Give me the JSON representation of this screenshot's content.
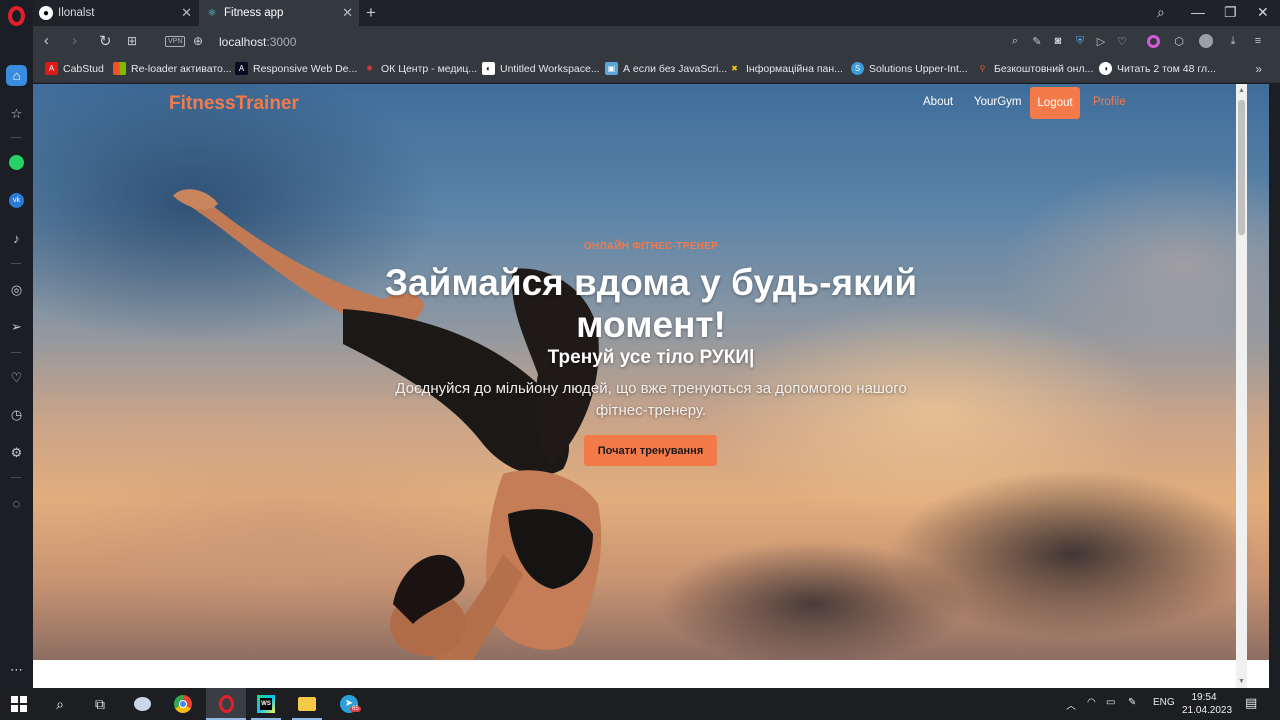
{
  "browser": {
    "tabs": [
      {
        "title": "Ilonalst",
        "icon": "github-icon"
      },
      {
        "title": "Fitness app",
        "icon": "react-icon"
      }
    ],
    "url_host": "localhost",
    "url_port": ":3000",
    "vpn_label": "VPN",
    "bookmarks": [
      "CabStud",
      "Re-loader активато...",
      "Responsive Web De...",
      "ОК Центр - медиц...",
      "Untitled Workspace...",
      "А если без JavaScri...",
      "Інформаційна пан...",
      "Solutions Upper-Int...",
      "Безкоштовний онл...",
      "Читать 2 том 48 гл..."
    ]
  },
  "site": {
    "brand": "FitnessTrainer",
    "nav": {
      "about": "About",
      "yourgym": "YourGym",
      "logout": "Logout",
      "profile": "Profile"
    },
    "hero": {
      "kicker": "ОНЛАЙН ФІТНЕС-ТРЕНЕР",
      "headline": "Займайся вдома у будь-який момент!",
      "typed": "Тренуй усе тіло РУКИ|",
      "subtitle": "Доєднуйся до мільйону людей, що вже тренуються за допомогою нашого фітнес-тренеру.",
      "cta": "Почати тренування"
    }
  },
  "taskbar": {
    "language": "ENG",
    "time": "19:54",
    "date": "21.04.2023",
    "telegram_badge": "65"
  },
  "colors": {
    "accent": "#f47a4a",
    "browser_dark": "#34383f"
  }
}
